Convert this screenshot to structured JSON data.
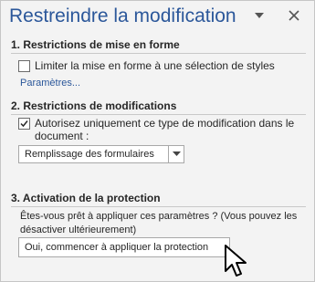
{
  "pane": {
    "title": "Restreindre la modification",
    "options_icon": "chevron-down-icon",
    "close_icon": "close-icon"
  },
  "formatting": {
    "heading": "1. Restrictions de mise en forme",
    "checkbox_label": "Limiter la mise en forme à une sélection de styles",
    "checkbox_checked": false,
    "settings_link": "Paramètres..."
  },
  "editing": {
    "heading": "2. Restrictions de modifications",
    "checkbox_label_line1": "Autorisez uniquement ce type de modification dans le",
    "checkbox_label_line2": "document :",
    "checkbox_checked": true,
    "dropdown_value": "Remplissage des formulaires"
  },
  "protection": {
    "heading": "3. Activation de la protection",
    "description": "Êtes-vous prêt à appliquer ces paramètres ? (Vous pouvez les désactiver ultérieurement)",
    "start_button": "Oui, commencer à appliquer la protection"
  },
  "colors": {
    "accent": "#2b579a",
    "pane_background": "#f3f3f3",
    "text": "#262626"
  }
}
